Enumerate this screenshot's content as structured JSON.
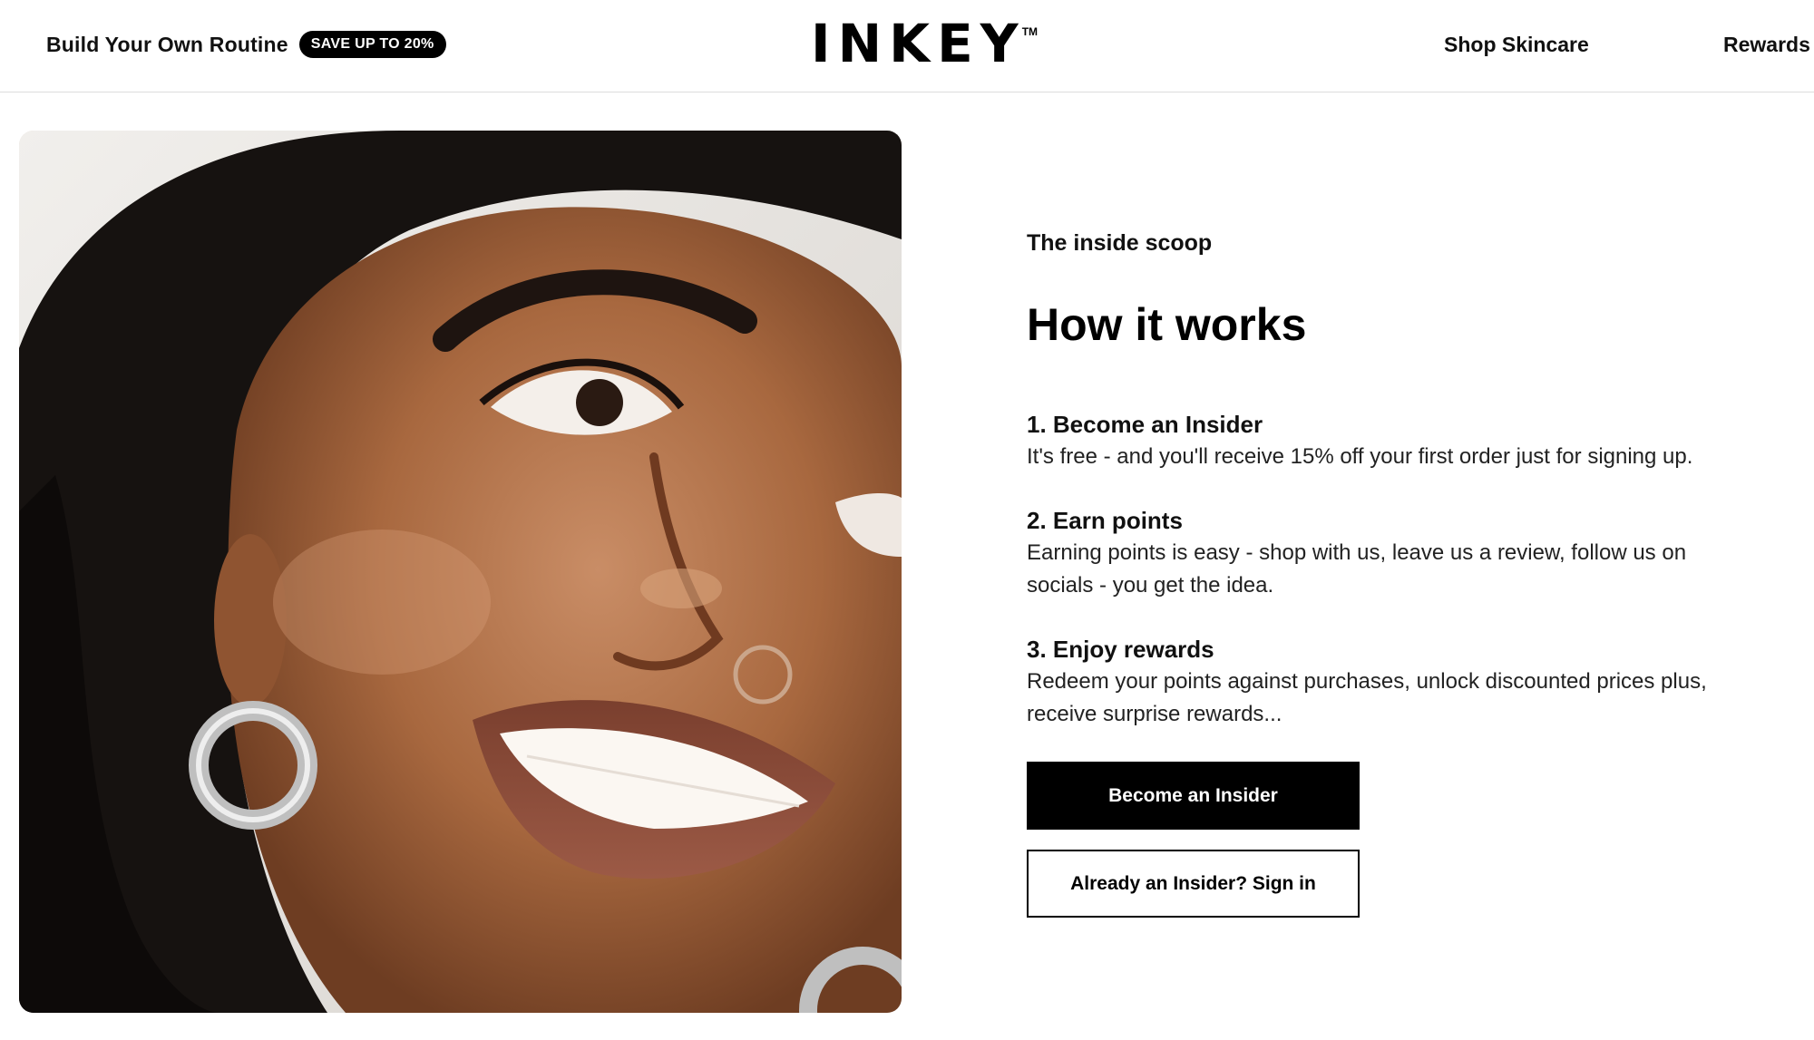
{
  "header": {
    "routine_link": "Build Your Own Routine",
    "badge": "SAVE UP TO 20%",
    "logo": "INKEY",
    "logo_tm": "TM",
    "nav": [
      {
        "label": "Shop Skincare"
      },
      {
        "label": "Rewards"
      }
    ]
  },
  "content": {
    "eyebrow": "The inside scoop",
    "title": "How it works",
    "steps": [
      {
        "title": "1. Become an Insider",
        "text": "It's free - and you'll receive 15% off your first order just for signing up."
      },
      {
        "title": "2. Earn points",
        "text": "Earning points is easy - shop with us, leave us a review, follow us on socials - you get the idea."
      },
      {
        "title": "3. Enjoy rewards",
        "text": "Redeem your points against purchases, unlock discounted prices plus, receive surprise rewards..."
      }
    ],
    "primary_button": "Become an Insider",
    "secondary_button": "Already an Insider? Sign in"
  },
  "colors": {
    "accent": "#000000",
    "background": "#ffffff",
    "divider": "#dcdcdc"
  }
}
